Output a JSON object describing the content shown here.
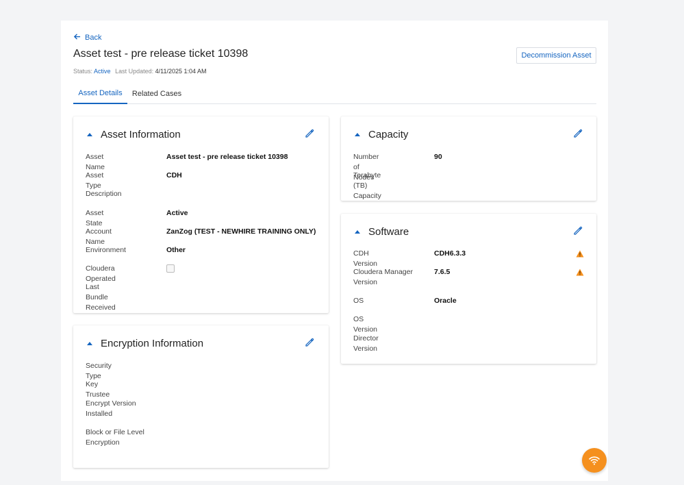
{
  "header": {
    "back_label": "Back",
    "title": "Asset test - pre release ticket 10398",
    "status_label": "Status:",
    "status_value": "Active",
    "last_updated_label": "Last Updated:",
    "last_updated_value": "4/11/2025 1:04 AM",
    "decommission_label": "Decommission Asset"
  },
  "tabs": [
    {
      "label": "Asset Details",
      "active": true
    },
    {
      "label": "Related Cases",
      "active": false
    }
  ],
  "asset_information": {
    "title": "Asset Information",
    "fields": [
      {
        "label": "Asset Name",
        "value": "Asset test - pre release ticket 10398"
      },
      {
        "label": "Asset Type",
        "value": "CDH"
      },
      {
        "label": "Description",
        "value": ""
      },
      {
        "label": "Asset State",
        "value": "Active"
      },
      {
        "label": "Account Name",
        "value": "ZanZog (TEST - NEWHIRE TRAINING ONLY)"
      },
      {
        "label": "Environment",
        "value": "Other"
      },
      {
        "label": "Cloudera Operated",
        "value": ""
      },
      {
        "label": "Last Bundle Received",
        "value": ""
      }
    ],
    "cloudera_operated_checked": false
  },
  "encryption_information": {
    "title": "Encryption Information",
    "fields": [
      {
        "label": "Security Type",
        "value": ""
      },
      {
        "label": "Key Trustee",
        "value": ""
      },
      {
        "label": "Encrypt Version Installed",
        "value": ""
      },
      {
        "label": "Block or File Level Encryption",
        "value": ""
      }
    ]
  },
  "capacity": {
    "title": "Capacity",
    "fields": [
      {
        "label": "Number of Nodes",
        "value": "90"
      },
      {
        "label": "Terabyte (TB) Capacity",
        "value": ""
      }
    ]
  },
  "software": {
    "title": "Software",
    "fields": [
      {
        "label": "CDH Version",
        "value": "CDH6.3.3",
        "warning": true
      },
      {
        "label": "Cloudera Manager Version",
        "value": "7.6.5",
        "warning": true
      },
      {
        "label": "OS",
        "value": "Oracle",
        "warning": false
      },
      {
        "label": "OS Version",
        "value": "",
        "warning": false
      },
      {
        "label": "Director Version",
        "value": "",
        "warning": false
      }
    ]
  },
  "icons": {
    "back": "arrow-left-icon",
    "edit": "pencil-icon",
    "warning": "warning-triangle-icon",
    "fab": "wifi-icon"
  },
  "colors": {
    "accent": "#1565c0",
    "warning": "#f5901e",
    "fab": "#f5901e"
  }
}
